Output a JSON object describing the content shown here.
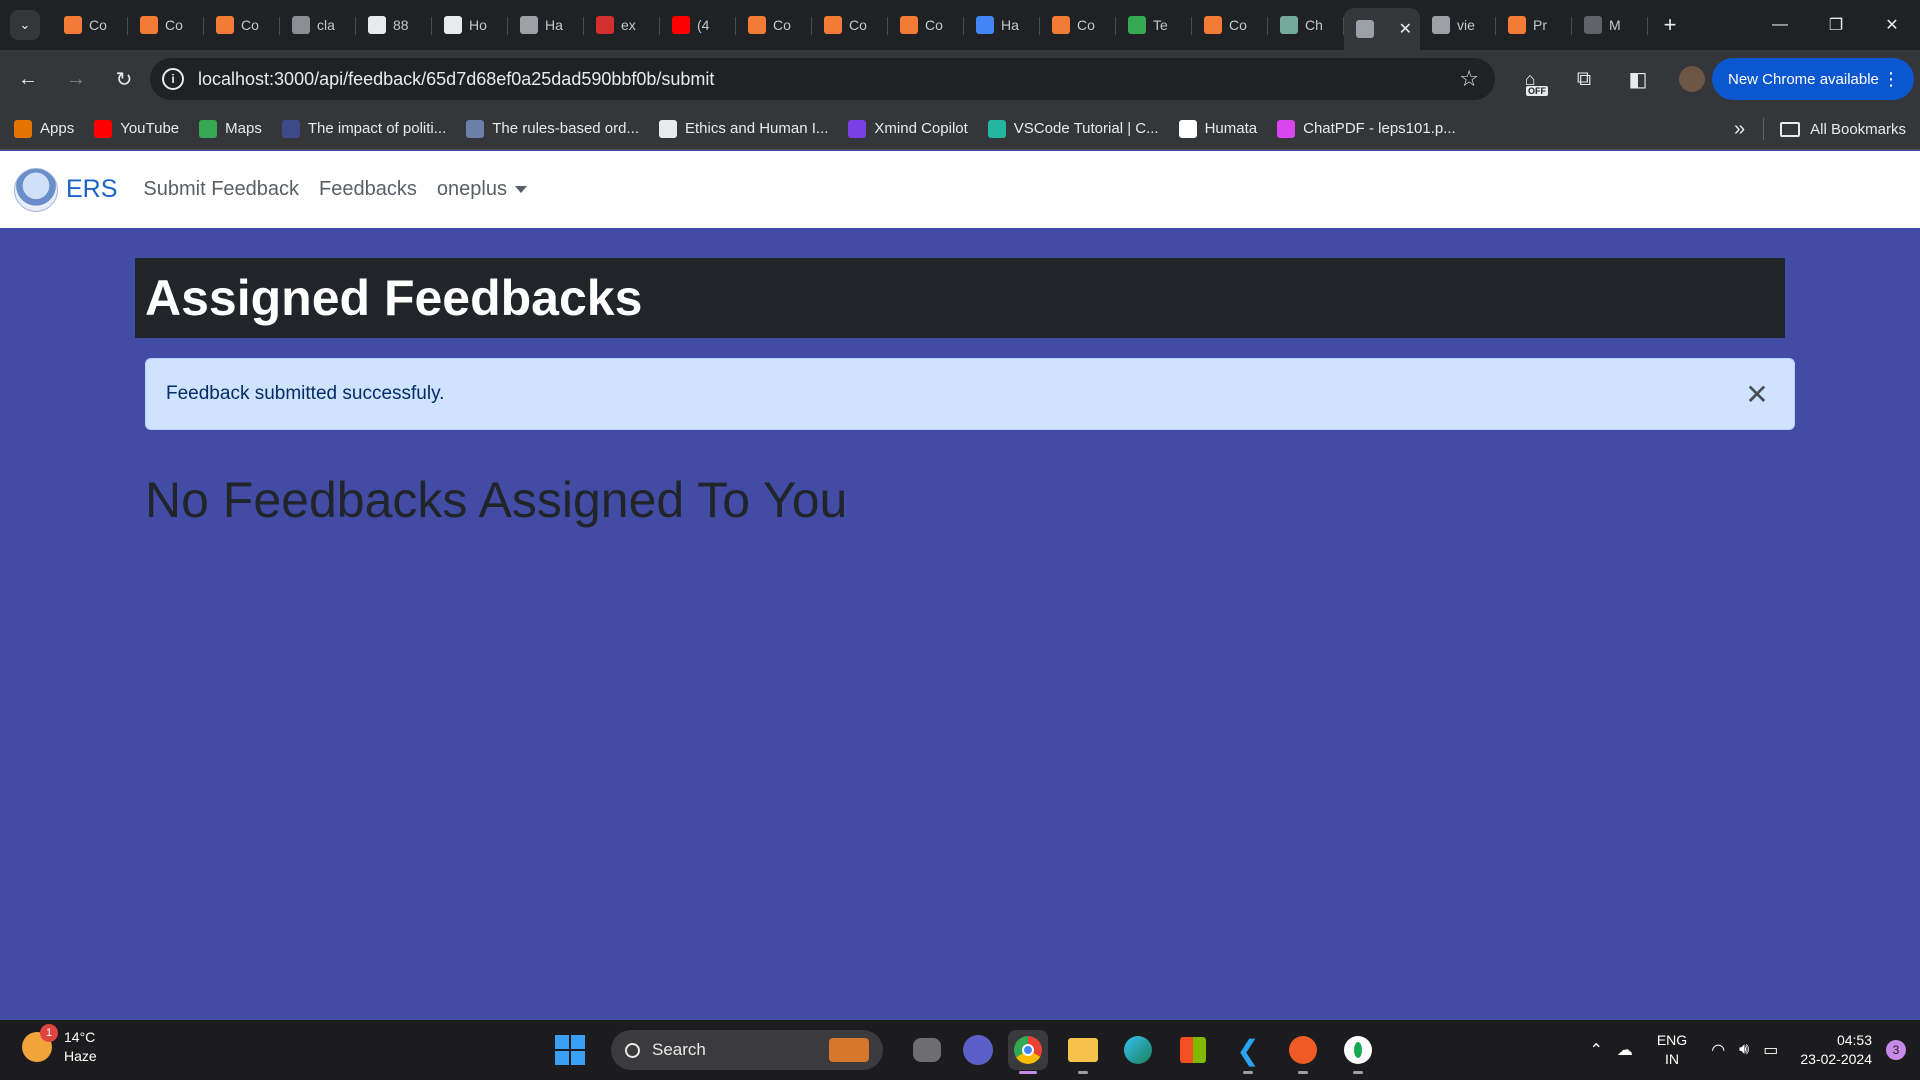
{
  "browser": {
    "tabs": [
      {
        "label": "Co",
        "icon": "coding-ninjas-icon",
        "color": "#f27b35"
      },
      {
        "label": "Co",
        "icon": "coding-ninjas-icon",
        "color": "#f27b35"
      },
      {
        "label": "Co",
        "icon": "coding-ninjas-icon",
        "color": "#f27b35"
      },
      {
        "label": "cla",
        "icon": "page-icon",
        "color": "#8a8d91"
      },
      {
        "label": "88",
        "icon": "github-icon",
        "color": "#e8eaed"
      },
      {
        "label": "Ho",
        "icon": "github-icon",
        "color": "#e8eaed"
      },
      {
        "label": "Ha",
        "icon": "globe-icon",
        "color": "#9aa0a6"
      },
      {
        "label": "ex",
        "icon": "red-square-icon",
        "color": "#d32f2f"
      },
      {
        "label": "(4",
        "icon": "youtube-icon",
        "color": "#ff0000"
      },
      {
        "label": "Co",
        "icon": "coding-ninjas-icon",
        "color": "#f27b35"
      },
      {
        "label": "Co",
        "icon": "coding-ninjas-icon",
        "color": "#f27b35"
      },
      {
        "label": "Co",
        "icon": "coding-ninjas-icon",
        "color": "#f27b35"
      },
      {
        "label": "Ha",
        "icon": "docs-icon",
        "color": "#4285f4"
      },
      {
        "label": "Co",
        "icon": "coding-ninjas-icon",
        "color": "#f27b35"
      },
      {
        "label": "Te",
        "icon": "drive-icon",
        "color": "#34a853"
      },
      {
        "label": "Co",
        "icon": "coding-ninjas-icon",
        "color": "#f27b35"
      },
      {
        "label": "Ch",
        "icon": "chatgpt-icon",
        "color": "#74aa9c"
      },
      {
        "label": "",
        "icon": "globe-icon",
        "color": "#9aa0a6",
        "active": true
      },
      {
        "label": "vie",
        "icon": "globe-icon",
        "color": "#9aa0a6"
      },
      {
        "label": "Pr",
        "icon": "coding-ninjas-icon",
        "color": "#f27b35"
      },
      {
        "label": "M",
        "icon": "page-icon",
        "color": "#5f6368"
      }
    ],
    "url": "localhost:3000/api/feedback/65d7d68ef0a25dad590bbf0b/submit",
    "update_button": "New Chrome available",
    "extension_badge": "OFF",
    "bookmarks": [
      {
        "label": "Apps",
        "icon": "apps-grid-icon",
        "color": "#e37400"
      },
      {
        "label": "YouTube",
        "icon": "youtube-icon",
        "color": "#ff0000"
      },
      {
        "label": "Maps",
        "icon": "maps-pin-icon",
        "color": "#34a853"
      },
      {
        "label": "The impact of politi...",
        "icon": "shield-icon",
        "color": "#3c4a8a"
      },
      {
        "label": "The rules-based ord...",
        "icon": "site-icon",
        "color": "#6b7fa8"
      },
      {
        "label": "Ethics and Human I...",
        "icon": "person-icon",
        "color": "#e8eaed"
      },
      {
        "label": "Xmind Copilot",
        "icon": "xmind-icon",
        "color": "#7b3fe4"
      },
      {
        "label": "VSCode Tutorial | C...",
        "icon": "vscode-tutorial-icon",
        "color": "#22b5a0"
      },
      {
        "label": "Humata",
        "icon": "humata-icon",
        "color": "#ffffff"
      },
      {
        "label": "ChatPDF - leps101.p...",
        "icon": "chatpdf-icon",
        "color": "#d946ef"
      }
    ],
    "all_bookmarks": "All Bookmarks"
  },
  "app": {
    "brand": "ERS",
    "nav": {
      "submit_feedback": "Submit Feedback",
      "feedbacks": "Feedbacks",
      "user": "oneplus"
    },
    "heading": "Assigned Feedbacks",
    "alert": "Feedback submitted successfuly.",
    "empty_message": "No Feedbacks Assigned To You"
  },
  "taskbar": {
    "weather_temp": "14°C",
    "weather_desc": "Haze",
    "weather_badge": "1",
    "search_label": "Search",
    "lang_top": "ENG",
    "lang_bottom": "IN",
    "time": "04:53",
    "date": "23-02-2024",
    "notifications": "3"
  }
}
